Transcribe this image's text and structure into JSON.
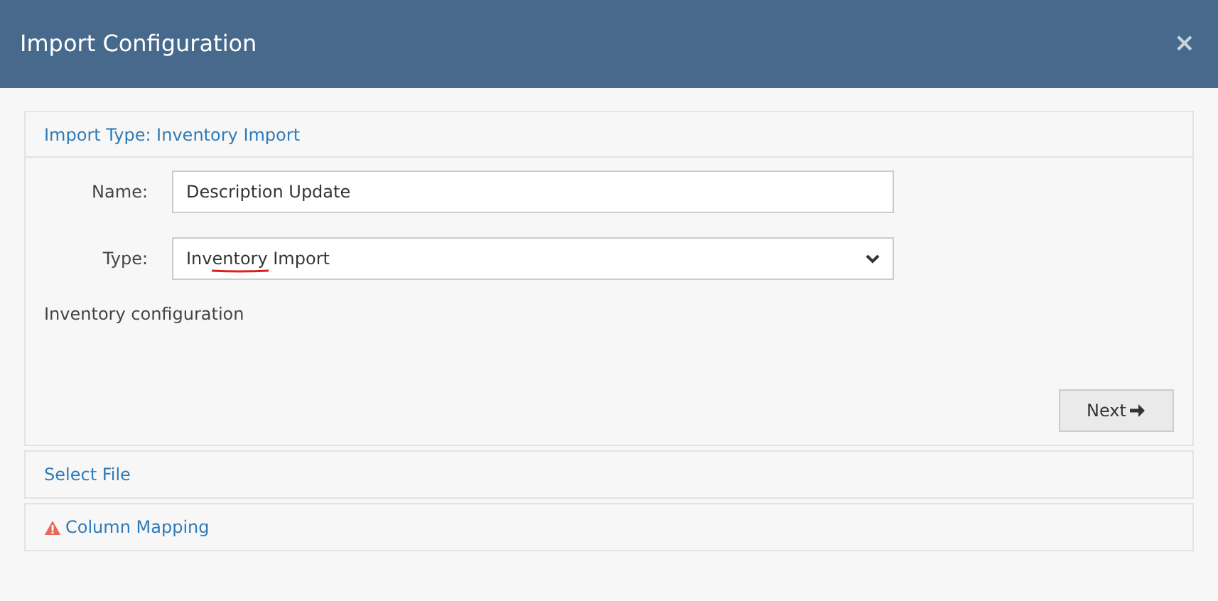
{
  "dialog": {
    "title": "Import Configuration",
    "close": "×"
  },
  "sections": [
    {
      "title": "Import Type: Inventory Import",
      "warning": false,
      "expanded": true,
      "form": {
        "fields": [
          {
            "kind": "text",
            "label": "Name:",
            "value": "Description Update"
          },
          {
            "kind": "select",
            "label": "Type:",
            "value": "Inventory Import",
            "spelling_error": true
          }
        ],
        "note": "Inventory configuration",
        "button": "Next"
      }
    },
    {
      "title": "Select File",
      "warning": false,
      "expanded": false
    },
    {
      "title": "Column Mapping",
      "warning": true,
      "expanded": false
    }
  ]
}
